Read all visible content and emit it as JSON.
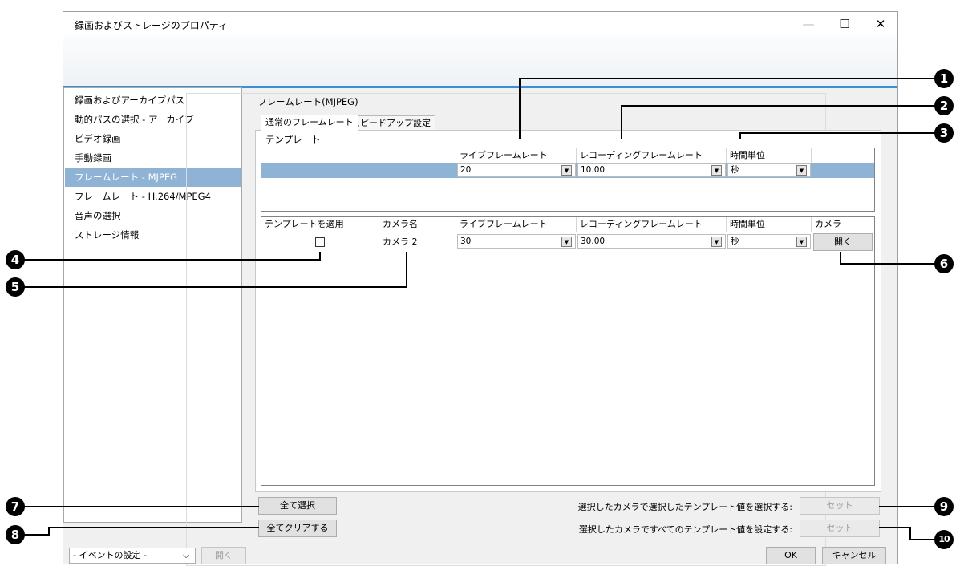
{
  "window": {
    "title": "録画およびストレージのプロパティ",
    "minimize": "—",
    "maximize": "☐",
    "close": "✕"
  },
  "sidebar": {
    "items": [
      {
        "label": "録画およびアーカイブパス"
      },
      {
        "label": "動的パスの選択 - アーカイブ"
      },
      {
        "label": "ビデオ録画"
      },
      {
        "label": "手動録画"
      },
      {
        "label": "フレームレート - MJPEG"
      },
      {
        "label": "フレームレート - H.264/MPEG4"
      },
      {
        "label": "音声の選択"
      },
      {
        "label": "ストレージ情報"
      }
    ],
    "selected_index": 4
  },
  "group": {
    "label": "フレームレート(MJPEG)"
  },
  "tabs": [
    {
      "label": "通常のフレームレート"
    },
    {
      "label": "スピードアップ設定"
    }
  ],
  "template": {
    "label": "テンプレート",
    "headers": {
      "live": "ライブフレームレート",
      "recording": "レコーディングフレームレート",
      "unit": "時間単位"
    },
    "row": {
      "live": "20",
      "recording": "10.00",
      "unit": "秒"
    }
  },
  "camera_table": {
    "headers": {
      "apply": "テンプレートを適用",
      "name": "カメラ名",
      "live": "ライブフレームレート",
      "recording": "レコーディングフレームレート",
      "unit": "時間単位",
      "camera": "カメラ"
    },
    "rows": [
      {
        "apply_checked": false,
        "name": "カメラ 2",
        "live": "30",
        "recording": "30.00",
        "unit": "秒",
        "open_button": "開く"
      }
    ]
  },
  "buttons": {
    "select_all": "全て選択",
    "clear_all": "全てクリアする",
    "set1_label": "選択したカメラで選択したテンプレート値を選択する:",
    "set1_button": "セット",
    "set2_label": "選択したカメラですべてのテンプレート値を設定する:",
    "set2_button": "セット",
    "ok": "OK",
    "cancel": "キャンセル"
  },
  "footer": {
    "event_select": "- イベントの設定 -",
    "event_open": "開く"
  },
  "callouts": [
    "1",
    "2",
    "3",
    "4",
    "5",
    "6",
    "7",
    "8",
    "9",
    "10"
  ],
  "colors": {
    "accent": "#3a8fd6",
    "selected_row": "#8eb3d4"
  }
}
